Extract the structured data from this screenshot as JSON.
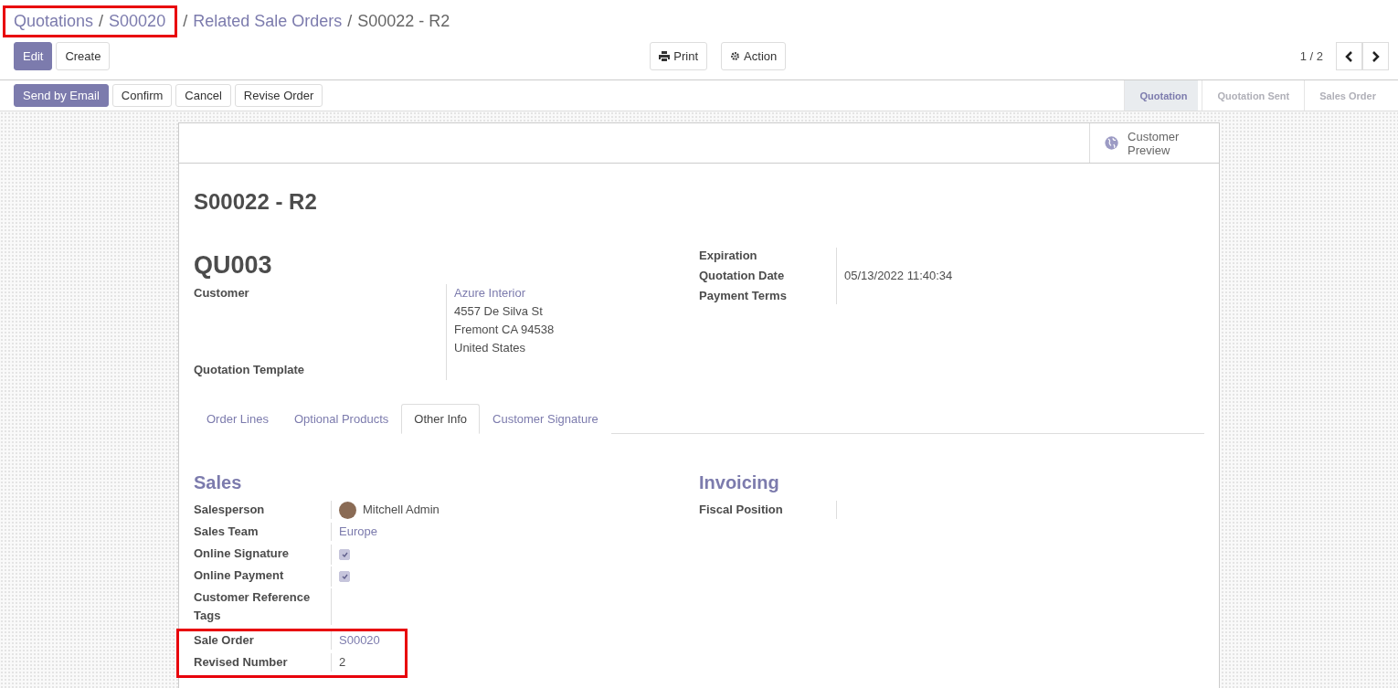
{
  "breadcrumb": {
    "separator": "/",
    "highlighted": [
      "Quotations",
      "S00020"
    ],
    "links": [
      "Related Sale Orders"
    ],
    "current": "S00022 - R2"
  },
  "buttons": {
    "primary": "Edit",
    "secondary": "Create",
    "print": "Print",
    "action": "Action"
  },
  "pager": "1 / 2",
  "status_buttons": [
    {
      "label": "Send by Email",
      "primary": true
    },
    {
      "label": "Confirm",
      "primary": false
    },
    {
      "label": "Cancel",
      "primary": false
    },
    {
      "label": "Revise Order",
      "primary": false
    }
  ],
  "stages": [
    {
      "label": "Quotation",
      "selected": true
    },
    {
      "label": "Quotation Sent",
      "selected": false
    },
    {
      "label": "Sales Order",
      "selected": false
    }
  ],
  "smart_button": "Customer Preview",
  "title": "S00022 - R2",
  "template_code": "QU003",
  "customer": {
    "label": "Customer",
    "name": "Azure Interior",
    "address": [
      "4557 De Silva St",
      "Fremont CA 94538",
      "United States"
    ]
  },
  "left_fields": [
    {
      "label": "Quotation Template"
    }
  ],
  "right_fields": [
    {
      "label": "Expiration"
    },
    {
      "label": "Quotation Date",
      "value": "05/13/2022 11:40:34"
    },
    {
      "label": "Payment Terms"
    }
  ],
  "tabs": [
    {
      "label": "Order Lines",
      "selected": false
    },
    {
      "label": "Optional Products",
      "selected": false
    },
    {
      "label": "Other Info",
      "selected": true
    },
    {
      "label": "Customer Signature",
      "selected": false
    }
  ],
  "sales": {
    "title": "Sales",
    "fields": [
      {
        "label": "Salesperson",
        "kind": "avatar",
        "value": "Mitchell Admin"
      },
      {
        "label": "Sales Team",
        "kind": "link",
        "value": "Europe"
      },
      {
        "label": "Online Signature",
        "kind": "checkbox",
        "checked": true
      },
      {
        "label": "Online Payment",
        "kind": "checkbox",
        "checked": true
      },
      {
        "label": "Customer Reference",
        "kind": "empty"
      },
      {
        "label": "Tags",
        "kind": "empty"
      }
    ],
    "highlighted_fields": [
      {
        "label": "Sale Order",
        "kind": "link",
        "value": "S00020"
      },
      {
        "label": "Revised Number",
        "kind": "text",
        "value": "2"
      }
    ]
  },
  "invoicing": {
    "title": "Invoicing",
    "fields": [
      {
        "label": "Fiscal Position"
      }
    ]
  }
}
